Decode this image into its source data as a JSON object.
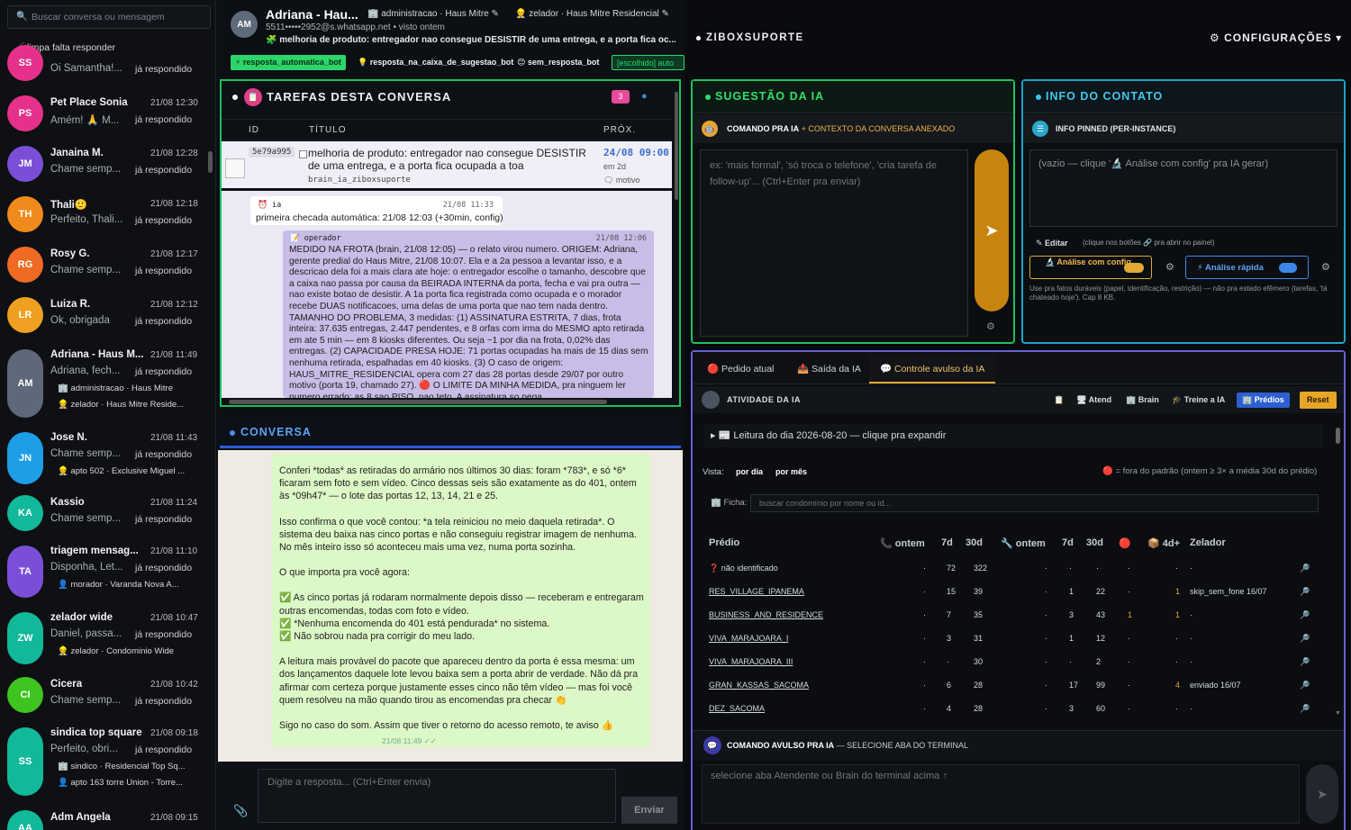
{
  "left": {
    "search_placeholder": "Buscar conversa ou mensagem",
    "clean_label": "limpa falta responder",
    "conversations": [
      {
        "initials": "SS",
        "color": "#e6318a",
        "name": "",
        "time": "",
        "preview": "Oi Samantha!...",
        "status": "já respondido",
        "tags": []
      },
      {
        "initials": "PS",
        "color": "#e6318a",
        "name": "Pet Place Sonia",
        "time": "21/08 12:30",
        "preview": "Amém! 🙏 M...",
        "status": "já respondido",
        "tags": []
      },
      {
        "initials": "JM",
        "color": "#7a4fd8",
        "name": "Janaina M.",
        "time": "21/08 12:28",
        "preview": "Chame semp...",
        "status": "já respondido",
        "tags": []
      },
      {
        "initials": "TH",
        "color": "#f08a1c",
        "name": "Thali🙂",
        "time": "21/08 12:18",
        "preview": "Perfeito, Thali...",
        "status": "já respondido",
        "tags": []
      },
      {
        "initials": "RG",
        "color": "#f06a24",
        "name": "Rosy G.",
        "time": "21/08 12:17",
        "preview": "Chame semp...",
        "status": "já respondido",
        "tags": []
      },
      {
        "initials": "LR",
        "color": "#f0a020",
        "name": "Luiza R.",
        "time": "21/08 12:12",
        "preview": "Ok, obrigada",
        "status": "já respondido",
        "tags": []
      },
      {
        "initials": "AM",
        "color": "#5e6878",
        "name": "Adriana - Haus M...",
        "time": "21/08 11:49",
        "preview": "Adriana, fech...",
        "status": "já respondido",
        "tags": [
          "🏢 administracao · Haus Mitre",
          "👷 zelador · Haus Mitre Reside..."
        ]
      },
      {
        "initials": "JN",
        "color": "#1e9ee6",
        "name": "Jose N.",
        "time": "21/08 11:43",
        "preview": "Chame semp...",
        "status": "já respondido",
        "tags": [
          "👷 apto 502 · Exclusive Miguel ..."
        ]
      },
      {
        "initials": "KA",
        "color": "#12b89a",
        "name": "Kassio",
        "time": "21/08 11:24",
        "preview": "Chame semp...",
        "status": "já respondido",
        "tags": []
      },
      {
        "initials": "TA",
        "color": "#7a4fd8",
        "name": "triagem mensag...",
        "time": "21/08 11:10",
        "preview": "Disponha, Let...",
        "status": "já respondido",
        "tags": [
          "👤 morador · Varanda Nova A..."
        ]
      },
      {
        "initials": "ZW",
        "color": "#12b89a",
        "name": "zelador wide",
        "time": "21/08 10:47",
        "preview": "Daniel, passa...",
        "status": "já respondido",
        "tags": [
          "👷 zelador · Condominio Wide"
        ]
      },
      {
        "initials": "CI",
        "color": "#3ec41e",
        "name": "Cicera",
        "time": "21/08 10:42",
        "preview": "Chame semp...",
        "status": "já respondido",
        "tags": []
      },
      {
        "initials": "SS",
        "color": "#12b89a",
        "name": "sindica top square",
        "time": "21/08 09:18",
        "preview": "Perfeito, obri...",
        "status": "já respondido",
        "tags": [
          "🏢 sindico · Residencial Top Sq...",
          "👤 apto 163 torre Union - Torre..."
        ]
      },
      {
        "initials": "AA",
        "color": "#12b89a",
        "name": "Adm Angela",
        "time": "21/08 09:15",
        "preview": "",
        "status": "",
        "tags": []
      }
    ]
  },
  "header": {
    "avatar": "AM",
    "name": "Adriana - Hau...",
    "admin": "🏢 administracao · Haus Mitre ✎",
    "zelador": "👷 zelador · Haus Mitre Residencial ✎",
    "phone": "5511•••••2952@s.whatsapp.net • visto ontem",
    "topic": "🧩 melhoria de produto: entregador nao consegue DESISTIR de uma entrega, e a porta fica oc...",
    "tags": [
      "⚡ resposta_automatica_bot",
      "💡 resposta_na_caixa_de_sugestao_bot",
      "😊 sem_resposta_bot",
      "[escolhido] auto"
    ]
  },
  "tasks": {
    "title": "TAREFAS DESTA CONVERSA",
    "count": "3",
    "columns": [
      "ID",
      "TÍTULO",
      "PRÓX."
    ],
    "row": {
      "id": "5e79a995",
      "title": "melhoria de produto: entregador nao consegue DESISTIR de uma entrega, e a porta fica ocupada a toa",
      "project": "brain_ia_ziboxsuporte",
      "date": "24/08 09:00",
      "ago": "em 2d",
      "motivo": "🗨 motivo"
    },
    "ia_msg": {
      "author": "ia",
      "time": "21/08 11:33",
      "text": "primeira checada automática: 21/08 12:03 (+30min, config)"
    },
    "op_msg": {
      "author": "operador",
      "time": "21/08 12:06",
      "text": "MEDIDO NA FROTA (brain, 21/08 12:05) — o relato virou numero. ORIGEM: Adriana, gerente predial do Haus Mitre, 21/08 10:07. Ela e a 2a pessoa a levantar isso, e a descricao dela foi a mais clara ate hoje: o entregador escolhe o tamanho, descobre que a caixa nao passa por causa da BEIRADA INTERNA da porta, fecha e vai pra outra — nao existe botao de desistir. A 1a porta fica registrada como ocupada e o morador recebe DUAS notificacoes, uma delas de uma porta que nao tem nada dentro. TAMANHO DO PROBLEMA, 3 medidas: (1) ASSINATURA ESTRITA, 7 dias, frota inteira: 37.635 entregas, 2.447 pendentes, e 8 orfas com irma do MESMO apto retirada em ate 5 min — em 8 kiosks diferentes. Ou seja ~1 por dia na frota, 0,02% das entregas. (2) CAPACIDADE PRESA HOJE: 71 portas ocupadas ha mais de 15 dias sem nenhuma retirada, espalhadas em 40 kiosks. (3) O caso de origem: HAUS_MITRE_RESIDENCIAL opera com 27 das 28 portas desde 29/07 por outro motivo (porta 19, chamado 27). 🔴 O LIMITE DA MINHA MEDIDA, pra ninguem ler numero errado: as 8 sao PISO, nao teto. A assinatura so pega"
    }
  },
  "conversa": {
    "title": "CONVERSA",
    "message": [
      "Conferi *todas* as retiradas do armário nos últimos 30 dias: foram *783*, e só *6* ficaram sem foto e sem vídeo. Cinco dessas seis são exatamente as do 401, ontem às *09h47* — o lote das portas 12, 13, 14, 21 e 25.",
      "Isso confirma o que você contou: *a tela reiniciou no meio daquela retirada*. O sistema deu baixa nas cinco portas e não conseguiu registrar imagem de nenhuma. No mês inteiro isso só aconteceu mais uma vez, numa porta sozinha.",
      "O que importa pra você agora:",
      "✅ As cinco portas já rodaram normalmente depois disso — receberam e entregaram outras encomendas, todas com foto e vídeo.\n✅ *Nenhuma encomenda do 401 está pendurada* no sistema.\n✅ Não sobrou nada pra corrigir do meu lado.",
      "A leitura mais provável do pacote que apareceu dentro da porta é essa mesma: um dos lançamentos daquele lote levou baixa sem a porta abrir de verdade. Não dá pra afirmar com certeza porque justamente esses cinco não têm vídeo — mas foi você quem resolveu na mão quando tirou as encomendas pra checar 👏",
      "Sigo no caso do som. Assim que tiver o retorno do acesso remoto, te aviso 👍"
    ],
    "msg_time": "21/08 11:49 ✓✓",
    "reply_placeholder": "Digite a resposta... (Ctrl+Enter envia)",
    "send_label": "Enviar"
  },
  "right": {
    "title": "ZIBOXSUPORTE",
    "config_label": "⚙ CONFIGURAÇÕES ▾",
    "sugestao": {
      "title": "SUGESTÃO DA IA",
      "sub_bold": "COMANDO PRA IA",
      "sub_rest": " + CONTEXTO DA CONVERSA ANEXADO",
      "placeholder": "ex: 'mais formal', 'só troca o telefone', 'cria tarefa de follow-up'... (Ctrl+Enter pra enviar)"
    },
    "info": {
      "title": "INFO DO CONTATO",
      "sub": "INFO PINNED (PER-INSTANCE)",
      "placeholder": "(vazio — clique '🔬 Análise com config' pra IA gerar)",
      "edit": "✎ Editar",
      "edit_note": "(clique nos botões 🔗 pra abrir no painel)",
      "btn1": "🔬 Análise com config",
      "btn2": "⚡ Análise rápida",
      "note": "Use pra fatos duráveis (papel, identificação, restrição) — não pra estado efêmero (tarefas, 'tá chateado hoje'). Cap 8 KB."
    },
    "terminal": {
      "tabs": [
        "🔴 Pedido atual",
        "📤 Saída da IA",
        "💬 Controle avulso da IA"
      ],
      "activity": "ATIVIDADE DA IA",
      "actions": [
        "📋",
        "🖥 Atend",
        "🏢 Brain",
        "🎓 Treine a IA",
        "🏢 Prédios",
        "Reset"
      ],
      "leitura": "▸ 📰 Leitura do dia 2026-08-20 — clique pra expandir",
      "vista_label": "Vista:",
      "vista_dia": "por dia",
      "vista_mes": "por mês",
      "legend": "🔴 = fora do padrão (ontem ≥ 3× a média 30d do prédio)",
      "ficha_label": "🏢 Ficha:",
      "ficha_placeholder": "buscar condomínio por nome ou id...",
      "columns": [
        "Prédio",
        "📞 ontem",
        "7d",
        "30d",
        "🔧 ontem",
        "7d",
        "30d",
        "🔴",
        "📦 4d+",
        "Zelador"
      ],
      "rows": [
        {
          "name": "❓ não identificado",
          "c1": "·",
          "c2": "72",
          "c3": "322",
          "c4": "·",
          "c5": "·",
          "c6": "·",
          "c7": "·",
          "c8": "·",
          "z": "·"
        },
        {
          "name": "RES_VILLAGE_IPANEMA",
          "c1": "·",
          "c2": "15",
          "c3": "39",
          "c4": "·",
          "c5": "1",
          "c6": "22",
          "c7": "·",
          "c8": "1",
          "z": "skip_sem_fone 16/07"
        },
        {
          "name": "BUSINESS_AND_RESIDENCE",
          "c1": "·",
          "c2": "7",
          "c3": "35",
          "c4": "·",
          "c5": "3",
          "c6": "43",
          "c7": "1",
          "c8": "1",
          "z": "·"
        },
        {
          "name": "VIVA_MARAJOARA_I",
          "c1": "·",
          "c2": "3",
          "c3": "31",
          "c4": "·",
          "c5": "1",
          "c6": "12",
          "c7": "·",
          "c8": "·",
          "z": "·"
        },
        {
          "name": "VIVA_MARAJOARA_III",
          "c1": "·",
          "c2": "·",
          "c3": "30",
          "c4": "·",
          "c5": "·",
          "c6": "2",
          "c7": "·",
          "c8": "·",
          "z": "·"
        },
        {
          "name": "GRAN_KASSAS_SACOMA",
          "c1": "·",
          "c2": "6",
          "c3": "28",
          "c4": "·",
          "c5": "17",
          "c6": "99",
          "c7": "·",
          "c8": "4",
          "z": "enviado 16/07"
        },
        {
          "name": "DEZ_SACOMA",
          "c1": "·",
          "c2": "4",
          "c3": "28",
          "c4": "·",
          "c5": "3",
          "c6": "60",
          "c7": "·",
          "c8": "·",
          "z": "·"
        }
      ],
      "avulso_bold": "COMANDO AVULSO PRA IA",
      "avulso_rest": " — SELECIONE ABA DO TERMINAL",
      "avulso_placeholder": "selecione aba Atendente ou Brain do terminal acima ↑"
    }
  }
}
